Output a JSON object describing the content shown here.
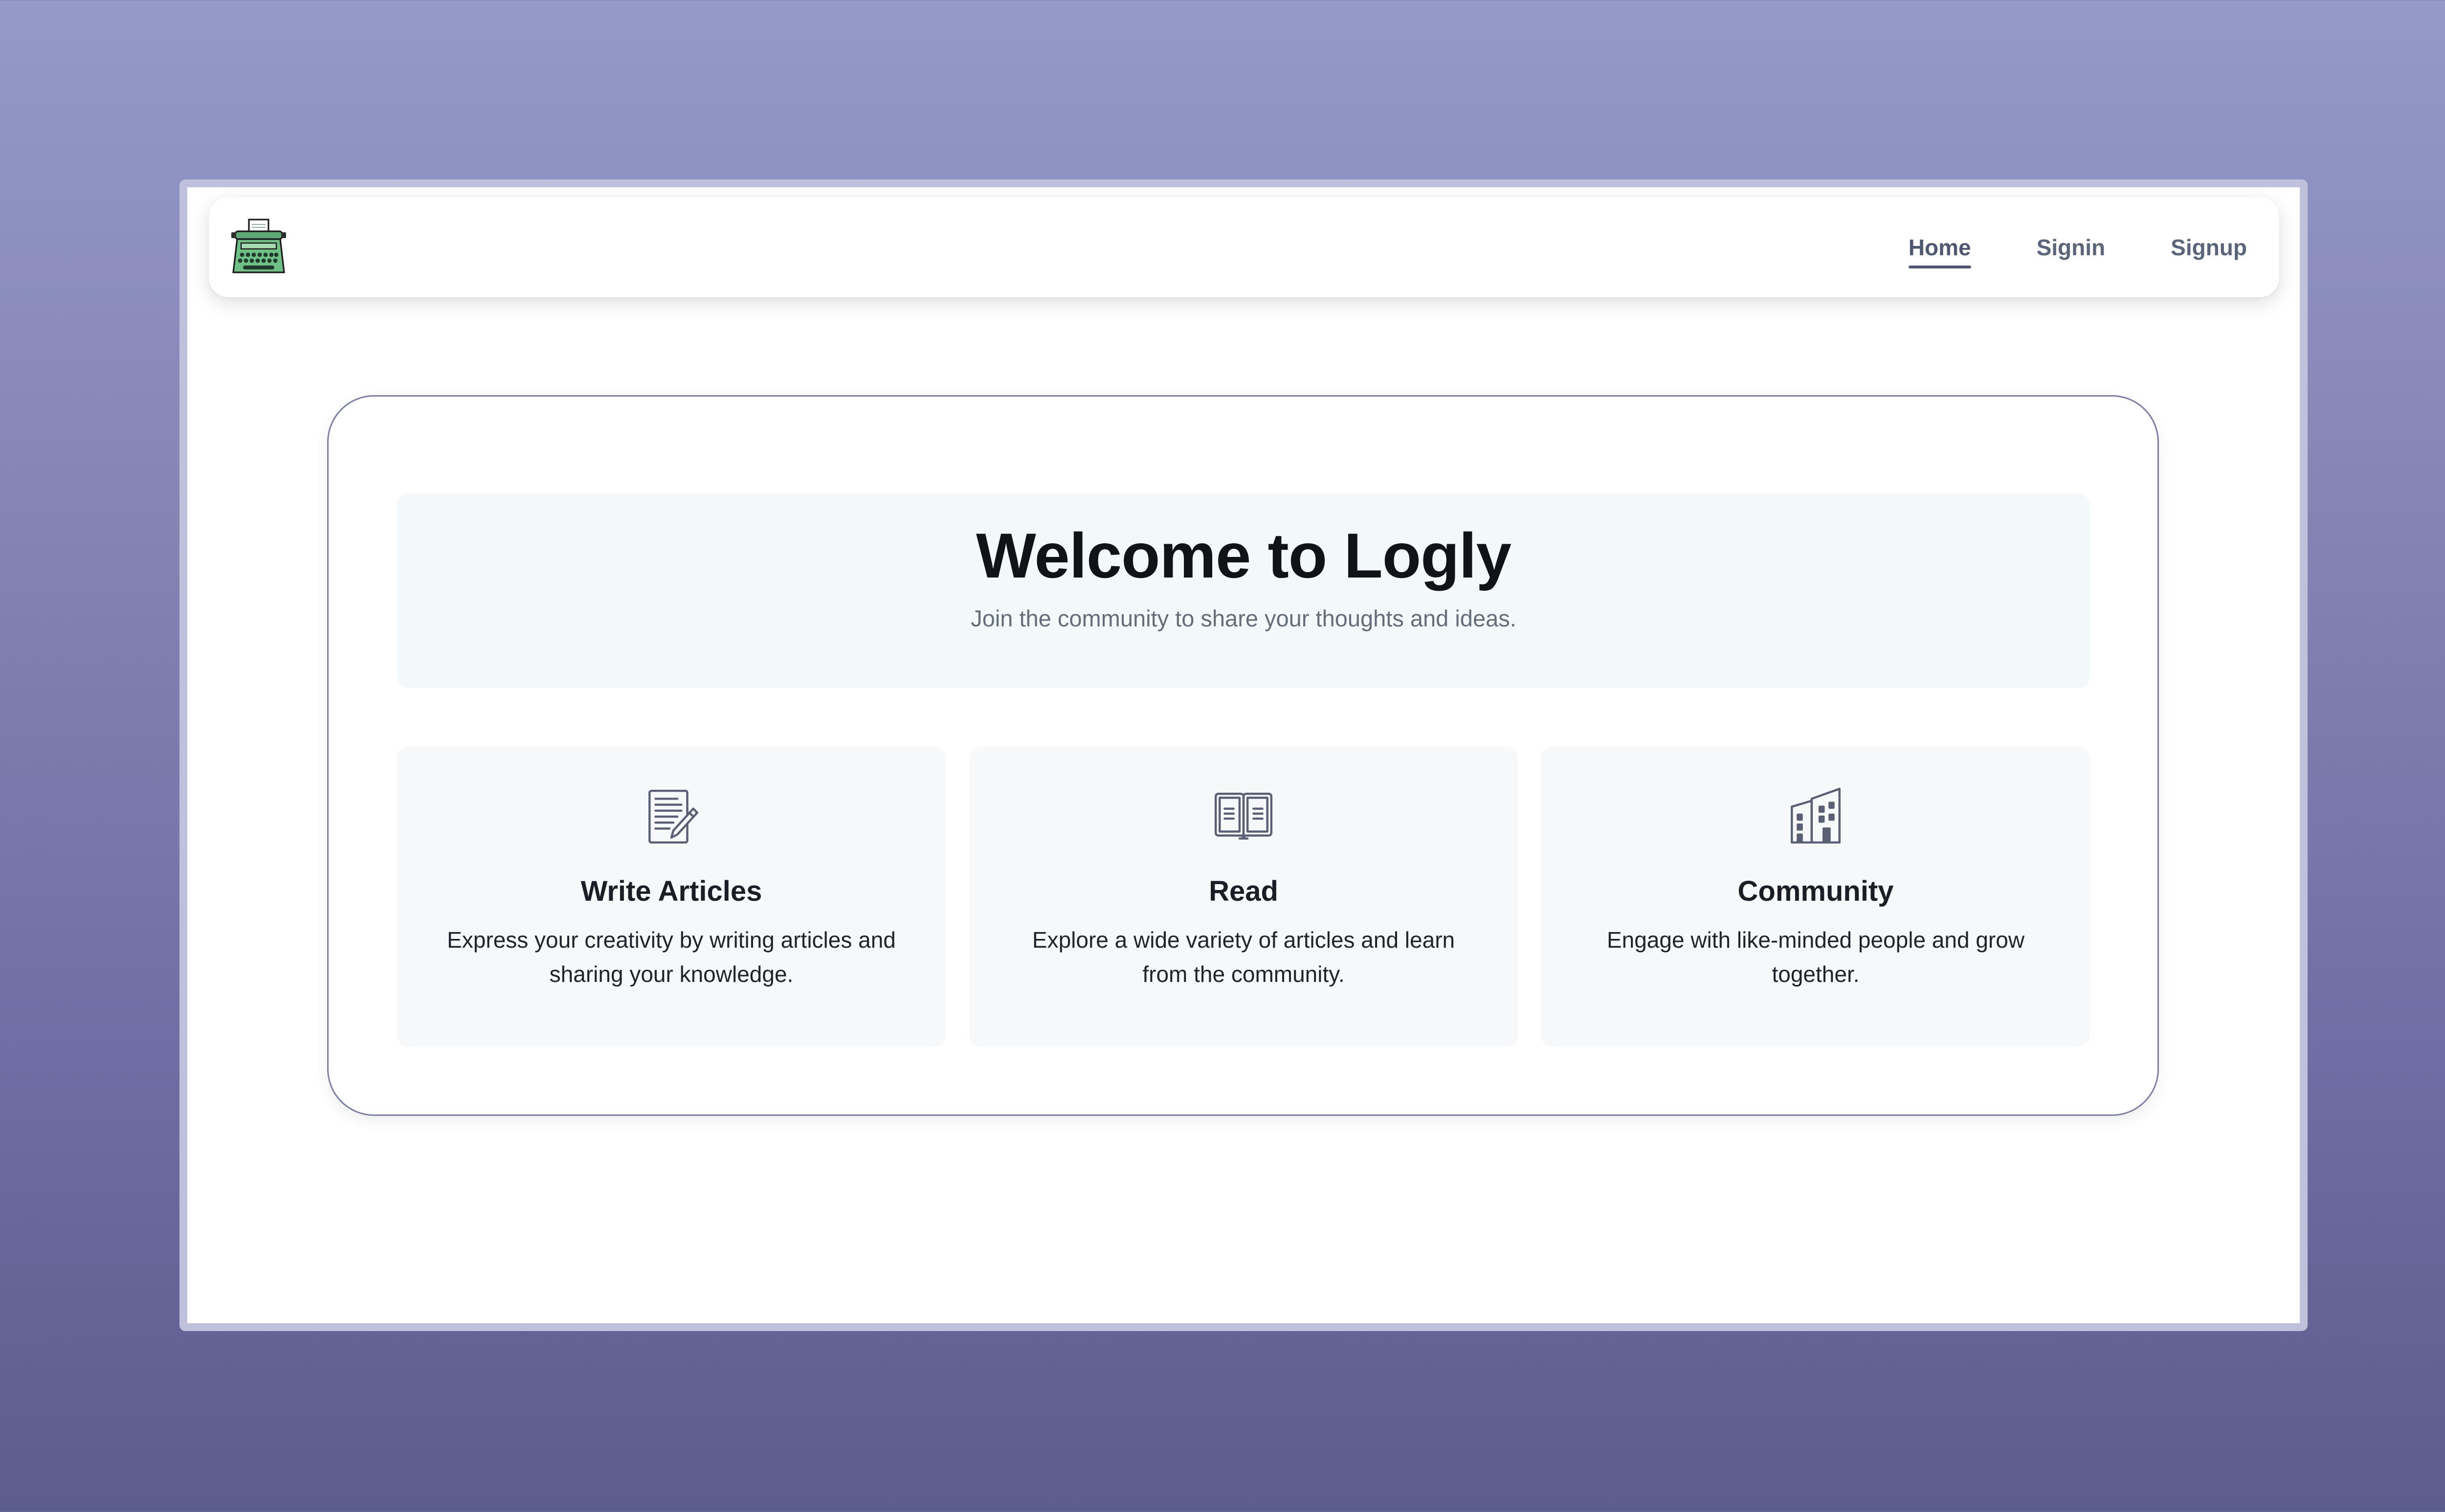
{
  "navbar": {
    "logo_icon": "typewriter-icon",
    "links": [
      {
        "label": "Home",
        "active": true
      },
      {
        "label": "Signin",
        "active": false
      },
      {
        "label": "Signup",
        "active": false
      }
    ]
  },
  "hero": {
    "title": "Welcome to Logly",
    "subtitle": "Join the community to share your thoughts and ideas."
  },
  "features": [
    {
      "icon": "write-article-icon",
      "title": "Write Articles",
      "description": "Express your creativity by writing articles and sharing your knowledge."
    },
    {
      "icon": "open-book-icon",
      "title": "Read",
      "description": "Explore a wide variety of articles and learn from the community."
    },
    {
      "icon": "buildings-icon",
      "title": "Community",
      "description": "Engage with like-minded people and grow together."
    }
  ],
  "colors": {
    "accent": "#4f5870",
    "logo_green": "#3c9a5f",
    "card_border": "#7d7fa2",
    "hero_background": "#f3f8fb"
  }
}
